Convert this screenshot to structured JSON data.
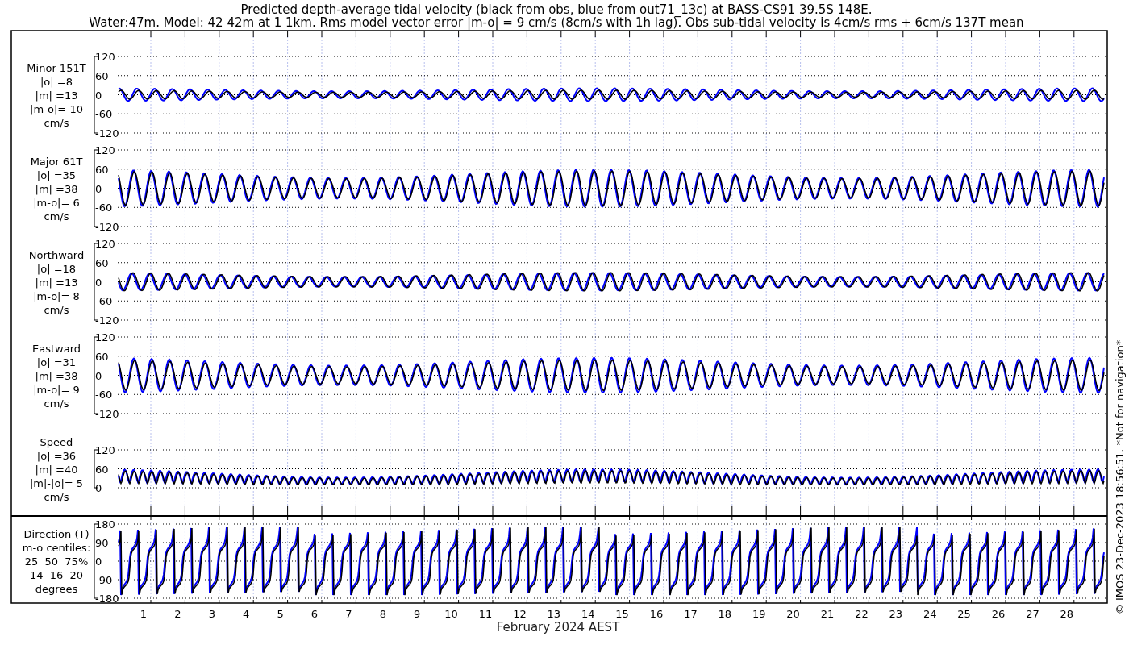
{
  "title": [
    "Predicted depth-average tidal velocity (black from obs, blue from out71_13c) at BASS-CS91 39.5S 148E.",
    "Water:47m. Model: 42 42m at 1 1km. Rms model vector error |m-o| = 9 cm/s (8cm/s with 1h lag). Obs sub-tidal velocity is 4cm/s rms + 6cm/s 137T mean"
  ],
  "panels": [
    {
      "kind": "minor",
      "labels": [
        "Minor 151T",
        "|o| =8",
        "|m| =13",
        "|m-o|= 10",
        "cm/s"
      ],
      "yticks": [
        "120",
        "60",
        "0",
        "-60",
        "-120"
      ]
    },
    {
      "kind": "major",
      "labels": [
        "Major 61T",
        "|o| =35",
        "|m| =38",
        "|m-o|= 6",
        "cm/s"
      ],
      "yticks": [
        "120",
        "60",
        "0",
        "-60",
        "-120"
      ]
    },
    {
      "kind": "north",
      "labels": [
        "Northward",
        "|o| =18",
        "|m| =13",
        "|m-o|= 8",
        "cm/s"
      ],
      "yticks": [
        "120",
        "60",
        "0",
        "-60",
        "-120"
      ]
    },
    {
      "kind": "east",
      "labels": [
        "Eastward",
        "|o| =31",
        "|m| =38",
        "|m-o|= 9",
        "cm/s"
      ],
      "yticks": [
        "120",
        "60",
        "0",
        "-60",
        "-120"
      ]
    },
    {
      "kind": "speed",
      "labels": [
        "Speed",
        "|o| =36",
        "|m| =40",
        "|m|-|o|= 5",
        "cm/s"
      ],
      "yticks": [
        "120",
        "60",
        "0"
      ]
    },
    {
      "kind": "direction",
      "labels": [
        "Direction (T)",
        "m-o centiles:",
        "25  50  75%",
        "14  16  20",
        "degrees"
      ],
      "yticks": [
        "180",
        "90",
        "0",
        "-90",
        "-180"
      ]
    }
  ],
  "x_axis": {
    "day_labels": [
      "1",
      "2",
      "3",
      "4",
      "5",
      "6",
      "7",
      "8",
      "9",
      "10",
      "11",
      "12",
      "13",
      "14",
      "15",
      "16",
      "17",
      "18",
      "19",
      "20",
      "21",
      "22",
      "23",
      "24",
      "25",
      "26",
      "27",
      "28"
    ],
    "label": "February 2024 AEST"
  },
  "credit": "© IMOS 23-Dec-2023 18:56:51. *Not for navigation*"
}
